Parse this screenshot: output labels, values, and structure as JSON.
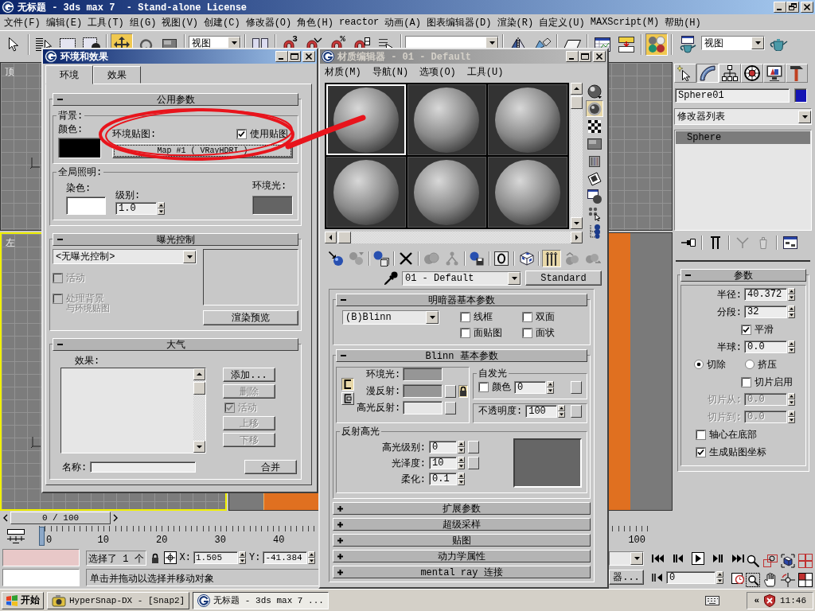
{
  "window": {
    "title": "无标题 - 3ds max 7  - Stand-alone License"
  },
  "menu_bar": [
    "文件(F)",
    "编辑(E)",
    "工具(T)",
    "组(G)",
    "视图(V)",
    "创建(C)",
    "修改器(O)",
    "角色(H)",
    "reactor",
    "动画(A)",
    "图表编辑器(D)",
    "渲染(R)",
    "自定义(U)",
    "MAXScript(M)",
    "帮助(H)"
  ],
  "main_toolbar": [
    {
      "kind": "tool",
      "selected": false
    },
    {
      "kind": "tool",
      "selected": false
    },
    {
      "kind": "tool",
      "selected": false
    },
    {
      "kind": "tool",
      "selected": false
    },
    {
      "kind": "tool",
      "selected": true
    },
    {
      "kind": "tool",
      "selected": false
    },
    {
      "kind": "tool",
      "selected": false
    },
    {
      "kind": "dropdown",
      "value": "视图"
    },
    {
      "kind": "tool",
      "selected": false
    },
    {
      "kind": "tool",
      "selected": false,
      "badge": "3"
    },
    {
      "kind": "tool",
      "selected": false
    },
    {
      "kind": "tool",
      "selected": false,
      "badge": "%"
    },
    {
      "kind": "tool",
      "selected": false
    },
    {
      "kind": "tool",
      "selected": false
    },
    {
      "kind": "dropdown"
    },
    {
      "kind": "tool",
      "selected": false
    },
    {
      "kind": "tool",
      "selected": false
    },
    {
      "kind": "tool",
      "selected": false
    },
    {
      "kind": "tool",
      "selected": false
    },
    {
      "kind": "tool",
      "selected": false
    },
    {
      "kind": "tool",
      "selected": true
    },
    {
      "kind": "tool",
      "selected": false
    },
    {
      "kind": "dropdown",
      "value": "视图"
    },
    {
      "kind": "tool",
      "selected": false
    }
  ],
  "viewports": [
    {
      "label": "顶",
      "kind": "grid",
      "active": false
    },
    {
      "kind": "grid",
      "active": false
    },
    {
      "label": "左",
      "kind": "grid",
      "active": true
    },
    {
      "kind": "shaded",
      "active": false
    }
  ],
  "time_slider": {
    "position": "0 / 100"
  },
  "track_bar": {
    "labels": [
      "0",
      "10",
      "20",
      "30",
      "40"
    ],
    "end_label": "100"
  },
  "command_panel": {
    "tabs": [
      {
        "selected": false
      },
      {
        "selected": true
      },
      {
        "selected": false
      },
      {
        "selected": false
      },
      {
        "selected": false
      },
      {
        "selected": false
      }
    ],
    "object": {
      "name": "Sphere01",
      "color": "#1414b4"
    },
    "modifier_list": "修改器列表",
    "stack": [
      {
        "label": "Sphere",
        "selected": true
      }
    ],
    "stack_buttons": [
      {
        "disabled": false
      },
      {
        "disabled": false
      },
      {
        "disabled": true
      },
      {
        "disabled": true
      },
      {
        "disabled": false
      }
    ],
    "parameters": {
      "header": "参数",
      "expanded": true,
      "rows": [
        {
          "kind": "spinner",
          "label": "半径:",
          "value": "40.372",
          "disabled": false
        },
        {
          "kind": "spinner",
          "label": "分段:",
          "value": "32",
          "disabled": false
        },
        {
          "kind": "checkbox",
          "label": "平滑",
          "checked": true
        },
        {
          "kind": "spinner",
          "label": "半球:",
          "value": "0.0",
          "disabled": false
        },
        {
          "kind": "radio",
          "options": [
            {
              "label": "切除",
              "selected": true
            },
            {
              "label": "挤压",
              "selected": false
            }
          ]
        },
        {
          "kind": "checkbox",
          "label": "切片启用",
          "checked": false
        },
        {
          "kind": "spinner",
          "label": "切片从:",
          "value": "0.0",
          "disabled": true
        },
        {
          "kind": "spinner",
          "label": "切片到:",
          "value": "0.0",
          "disabled": true
        }
      ],
      "options": [
        {
          "label": "轴心在底部",
          "checked": false
        },
        {
          "label": "生成贴图坐标",
          "checked": true
        }
      ]
    }
  },
  "status_bar": {
    "selection": "选择了 1 个",
    "x_label": "X:",
    "x_value": "1.505",
    "y_label": "Y:",
    "y_value": "-41.384",
    "prompt": "单击并拖动以选择并移动对象"
  },
  "animation_controls": {
    "key_filters_button": "器...",
    "current_frame": "0"
  },
  "taskbar": {
    "start": "开始",
    "tasks": [
      {
        "label": "HyperSnap-DX - [Snap2]",
        "selected": false
      },
      {
        "label": "无标题 - 3ds max 7 ...",
        "selected": true
      }
    ],
    "tray_expand": "«",
    "clock": "11:46"
  },
  "environment_dialog": {
    "title": "环境和效果",
    "active": true,
    "tabs": [
      {
        "label": "环境",
        "selected": true
      },
      {
        "label": "效果",
        "selected": false
      }
    ],
    "common_parameters": {
      "header": "公用参数",
      "expanded": true,
      "background": {
        "label": "背景:",
        "color_label": "颜色:",
        "color": "#000000",
        "env_map_label": "环境贴图:",
        "use_map": {
          "label": "使用贴图",
          "checked": true
        },
        "map_button": "Map #1  ( VRayHDRI )"
      },
      "global_lighting": {
        "label": "全局照明:",
        "tint": {
          "label": "染色:",
          "color": "#ffffff"
        },
        "level_label": "级别:",
        "level_value": "1.0",
        "ambient": {
          "label": "环境光:",
          "color": "#646464"
        }
      }
    },
    "exposure_control": {
      "header": "曝光控制",
      "expanded": true,
      "type": "<无曝光控制>",
      "active": {
        "label": "活动",
        "checked": false,
        "disabled": true
      },
      "process_background": {
        "label": "处理背景",
        "label_line2": "与环境贴图",
        "checked": false,
        "disabled": true
      },
      "preview_button": "渲染预览"
    },
    "atmosphere": {
      "header": "大气",
      "expanded": true,
      "effects_label": "效果:",
      "controls": [
        {
          "kind": "button",
          "label": "添加...",
          "disabled": false
        },
        {
          "kind": "button",
          "label": "删除",
          "disabled": true
        },
        {
          "kind": "checkbox",
          "label": "活动",
          "checked": true,
          "disabled": true
        },
        {
          "kind": "button",
          "label": "上移",
          "disabled": true
        },
        {
          "kind": "button",
          "label": "下移",
          "disabled": true
        }
      ],
      "name_label": "名称:",
      "merge_button": "合并"
    }
  },
  "material_editor": {
    "title": "材质编辑器 - 01 - Default",
    "active": false,
    "menu": [
      "材质(M)",
      "导航(N)",
      "选项(O)",
      "工具(U)"
    ],
    "sample_slots": [
      {
        "selected": true
      },
      {
        "selected": false
      },
      {
        "selected": false
      },
      {
        "selected": false
      },
      {
        "selected": false
      },
      {
        "selected": false
      }
    ],
    "side_tools": [
      {
        "selected": false
      },
      {
        "selected": true
      },
      {
        "selected": false
      },
      {
        "selected": false
      },
      {
        "selected": false
      },
      {
        "selected": false
      },
      {
        "selected": false
      },
      {
        "selected": false
      },
      {
        "selected": false
      }
    ],
    "toolbar": [
      {
        "selected": false,
        "disabled": false
      },
      {
        "selected": false,
        "disabled": true
      },
      {
        "selected": false,
        "disabled": false
      },
      {
        "selected": false,
        "disabled": false
      },
      {
        "selected": false,
        "disabled": true
      },
      {
        "selected": false,
        "disabled": true
      },
      {
        "selected": false,
        "disabled": false
      },
      {
        "selected": false,
        "disabled": false
      },
      {
        "selected": false,
        "disabled": false
      },
      {
        "selected": true,
        "disabled": false
      },
      {
        "selected": false,
        "disabled": true
      },
      {
        "selected": false,
        "disabled": true
      }
    ],
    "material_name": "01 - Default",
    "type_button": "Standard",
    "shader": {
      "header": "明暗器基本参数",
      "expanded": true,
      "type": "(B)Blinn",
      "options": [
        {
          "label": "线框",
          "checked": false
        },
        {
          "label": "双面",
          "checked": false
        },
        {
          "label": "面贴图",
          "checked": false
        },
        {
          "label": "面状",
          "checked": false
        }
      ]
    },
    "blinn": {
      "header": "Blinn 基本参数",
      "expanded": true,
      "color_locks": [
        {
          "on": true
        },
        {
          "on": false
        }
      ],
      "map_lock": {
        "on": true
      },
      "colors": [
        {
          "label": "环境光:",
          "color": "#969696",
          "map_button": false
        },
        {
          "label": "漫反射:",
          "color": "#969696",
          "map_button": true
        },
        {
          "label": "高光反射:",
          "color": "#e6e6e6",
          "map_button": true
        }
      ],
      "self_illumination": {
        "title": "自发光",
        "color": {
          "label": "颜色",
          "checked": false
        },
        "value": "0"
      },
      "opacity": {
        "label": "不透明度:",
        "value": "100"
      },
      "specular_highlights": {
        "title": "反射高光",
        "fields": [
          {
            "label": "高光级别:",
            "value": "0",
            "map_button": true
          },
          {
            "label": "光泽度:",
            "value": "10",
            "map_button": true
          },
          {
            "label": "柔化:",
            "value": "0.1",
            "map_button": false
          }
        ]
      }
    },
    "collapsed_rollouts": [
      {
        "header": "扩展参数",
        "expanded": false
      },
      {
        "header": "超级采样",
        "expanded": false
      },
      {
        "header": "贴图",
        "expanded": false
      },
      {
        "header": "动力学属性",
        "expanded": false
      },
      {
        "header": "mental ray 连接",
        "expanded": false
      }
    ]
  },
  "annotations": [
    {
      "kind": "circle_and_arrow"
    }
  ]
}
